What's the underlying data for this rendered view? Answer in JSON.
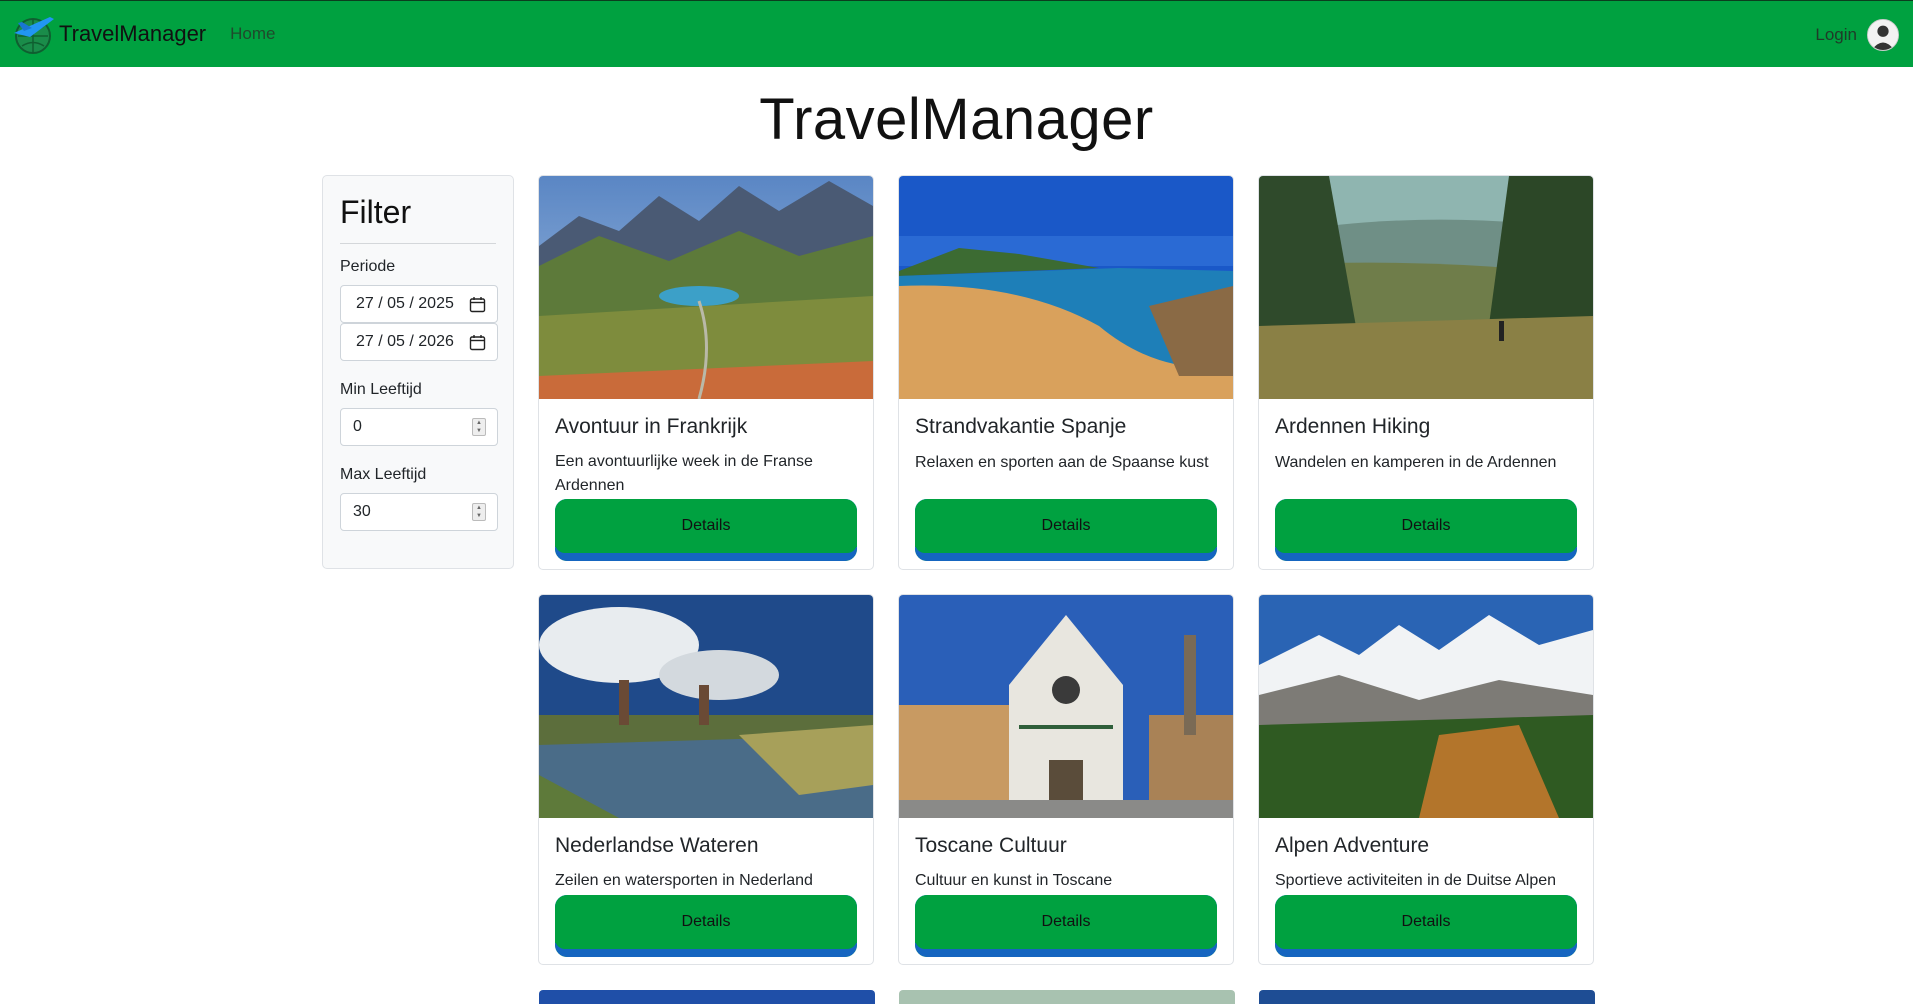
{
  "navbar": {
    "brand": "TravelManager",
    "home_label": "Home",
    "login_label": "Login",
    "color": "#00a140"
  },
  "page": {
    "title": "TravelManager"
  },
  "filter": {
    "title": "Filter",
    "periode_label": "Periode",
    "date_from": "27 / 05 / 2025",
    "date_to": "27 / 05 / 2026",
    "min_age_label": "Min Leeftijd",
    "min_age_value": "0",
    "max_age_label": "Max Leeftijd",
    "max_age_value": "30"
  },
  "trips": [
    {
      "title": "Avontuur in Frankrijk",
      "description": "Een avontuurlijke week in de Franse Ardennen",
      "button": "Details",
      "image": "mountain-valley-photo"
    },
    {
      "title": "Strandvakantie Spanje",
      "description": "Relaxen en sporten aan de Spaanse kust",
      "button": "Details",
      "image": "beach-bay-photo"
    },
    {
      "title": "Ardennen Hiking",
      "description": "Wandelen en kamperen in de Ardennen",
      "button": "Details",
      "image": "forest-hiker-photo"
    },
    {
      "title": "Nederlandse Wateren",
      "description": "Zeilen en watersporten in Nederland",
      "button": "Details",
      "image": "windmill-canal-photo"
    },
    {
      "title": "Toscane Cultuur",
      "description": "Cultuur en kunst in Toscane",
      "button": "Details",
      "image": "church-facade-photo"
    },
    {
      "title": "Alpen Adventure",
      "description": "Sportieve activiteiten in de Duitse Alpen",
      "button": "Details",
      "image": "alpine-peaks-photo"
    }
  ]
}
